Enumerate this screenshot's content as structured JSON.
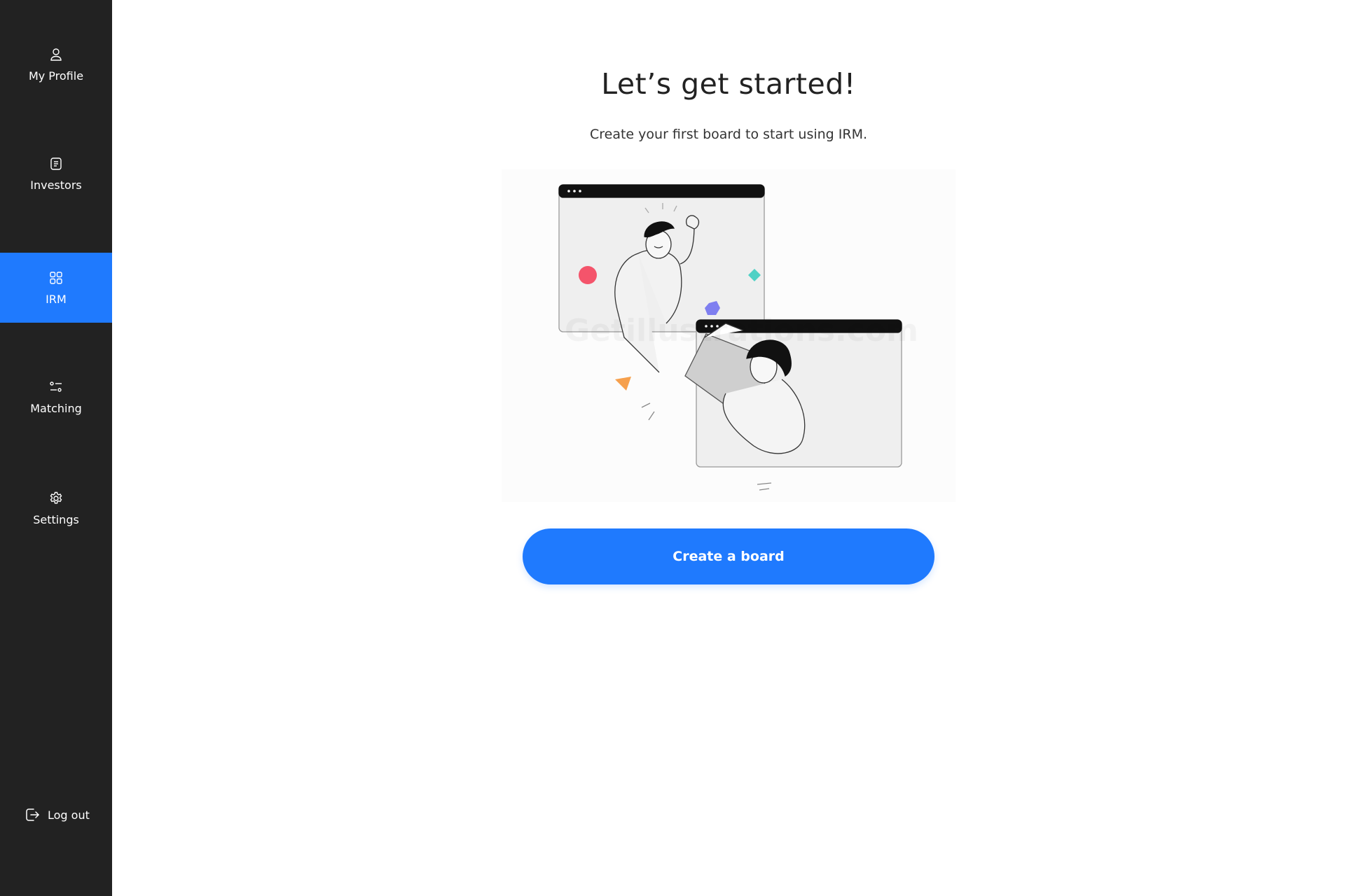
{
  "sidebar": {
    "items": [
      {
        "id": "my-profile",
        "label": "My Profile",
        "icon": "user-icon",
        "active": false
      },
      {
        "id": "investors",
        "label": "Investors",
        "icon": "document-icon",
        "active": false
      },
      {
        "id": "irm",
        "label": "IRM",
        "icon": "grid-icon",
        "active": true
      },
      {
        "id": "matching",
        "label": "Matching",
        "icon": "filter-icon",
        "active": false
      },
      {
        "id": "settings",
        "label": "Settings",
        "icon": "gear-icon",
        "active": false
      }
    ],
    "logout": {
      "label": "Log out",
      "icon": "logout-icon"
    }
  },
  "main": {
    "title": "Let’s get started!",
    "subtitle": "Create your first board to start using IRM.",
    "illustration": {
      "icon": "collaboration-illustration",
      "watermark": "Getillustrations.com"
    },
    "cta_label": "Create a board"
  },
  "colors": {
    "sidebar_bg": "#222222",
    "accent": "#1f7afe",
    "text_dark": "#222222",
    "illustration_red": "#f4546b",
    "illustration_teal": "#4fd1c5",
    "illustration_purple": "#7f7ff0",
    "illustration_orange": "#f6a04d"
  }
}
